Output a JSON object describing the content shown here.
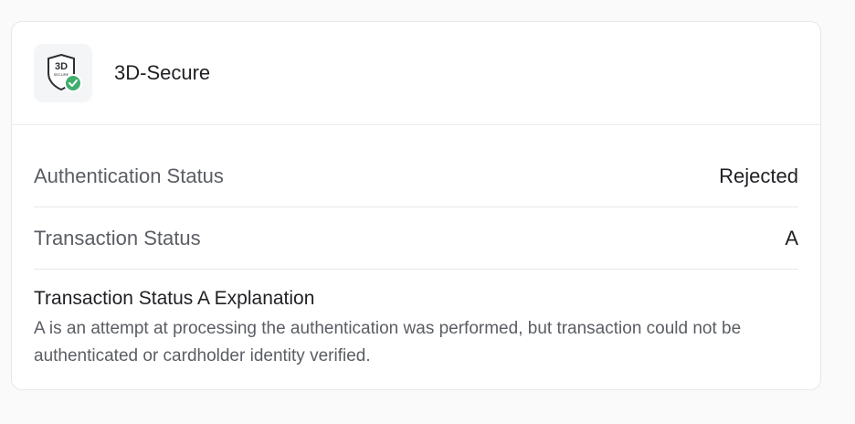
{
  "card": {
    "title": "3D-Secure",
    "logo": {
      "icon": "3d-secure-shield-icon",
      "badge_text": "3D",
      "sub_text": "SECURE",
      "check_color": "#3fae6e"
    },
    "rows": [
      {
        "label": "Authentication Status",
        "value": "Rejected"
      },
      {
        "label": "Transaction Status",
        "value": "A"
      }
    ],
    "explanation": {
      "title": "Transaction Status A Explanation",
      "text": "A is an attempt at processing the authentication was performed, but transaction could not be authenticated or cardholder identity verified."
    }
  }
}
